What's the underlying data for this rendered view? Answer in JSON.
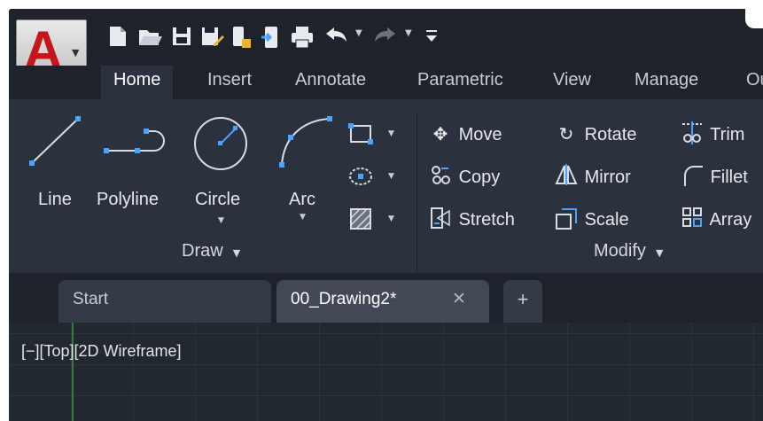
{
  "app": {
    "logo_letter": "A"
  },
  "quick_access": {
    "icons": [
      "new-icon",
      "open-icon",
      "save-icon",
      "save-as-icon",
      "open-from-web-icon",
      "save-to-web-icon",
      "plot-icon",
      "undo-icon",
      "redo-icon",
      "customize-icon"
    ]
  },
  "ribbon_tabs": [
    "Home",
    "Insert",
    "Annotate",
    "Parametric",
    "View",
    "Manage",
    "Ou"
  ],
  "draw_panel": {
    "title": "Draw",
    "tools": {
      "line": "Line",
      "polyline": "Polyline",
      "circle": "Circle",
      "arc": "Arc"
    }
  },
  "modify_panel": {
    "title": "Modify",
    "commands": {
      "move": "Move",
      "copy": "Copy",
      "stretch": "Stretch",
      "rotate": "Rotate",
      "mirror": "Mirror",
      "scale": "Scale",
      "trim": "Trim",
      "fillet": "Fillet",
      "array": "Array"
    }
  },
  "file_tabs": {
    "start": "Start",
    "drawing": "00_Drawing2*",
    "close_glyph": "✕",
    "new_glyph": "+"
  },
  "viewport": {
    "label": "[−][Top][2D Wireframe]"
  },
  "colors": {
    "accent_blue": "#4aa3ff",
    "logo_red": "#c4161c",
    "axis_green": "#2e7d32"
  }
}
